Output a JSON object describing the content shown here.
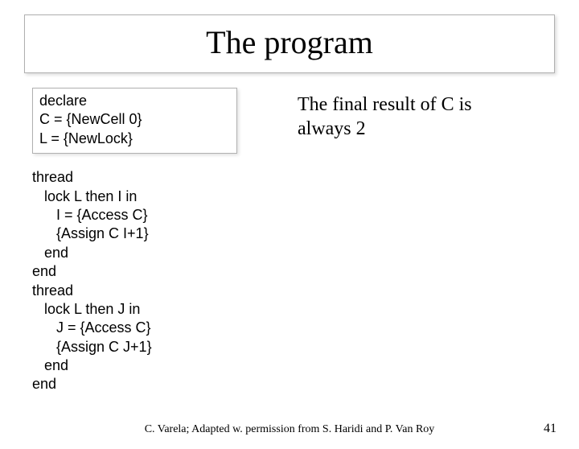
{
  "title": "The program",
  "declare": {
    "line1": "declare",
    "line2": "C = {NewCell 0}",
    "line3": "L = {NewLock}"
  },
  "code": {
    "l1": "thread",
    "l2": "   lock L then I in",
    "l3": "      I = {Access C}",
    "l4": "      {Assign C I+1}",
    "l5": "   end",
    "l6": "end",
    "l7": "thread",
    "l8": "   lock L then J in",
    "l9": "      J = {Access C}",
    "l10": "      {Assign C J+1}",
    "l11": "   end",
    "l12": "end"
  },
  "result": {
    "line1": "The final result of C is",
    "line2": "always 2"
  },
  "footer": "C. Varela;  Adapted w. permission from S. Haridi and P. Van Roy",
  "page": "41"
}
